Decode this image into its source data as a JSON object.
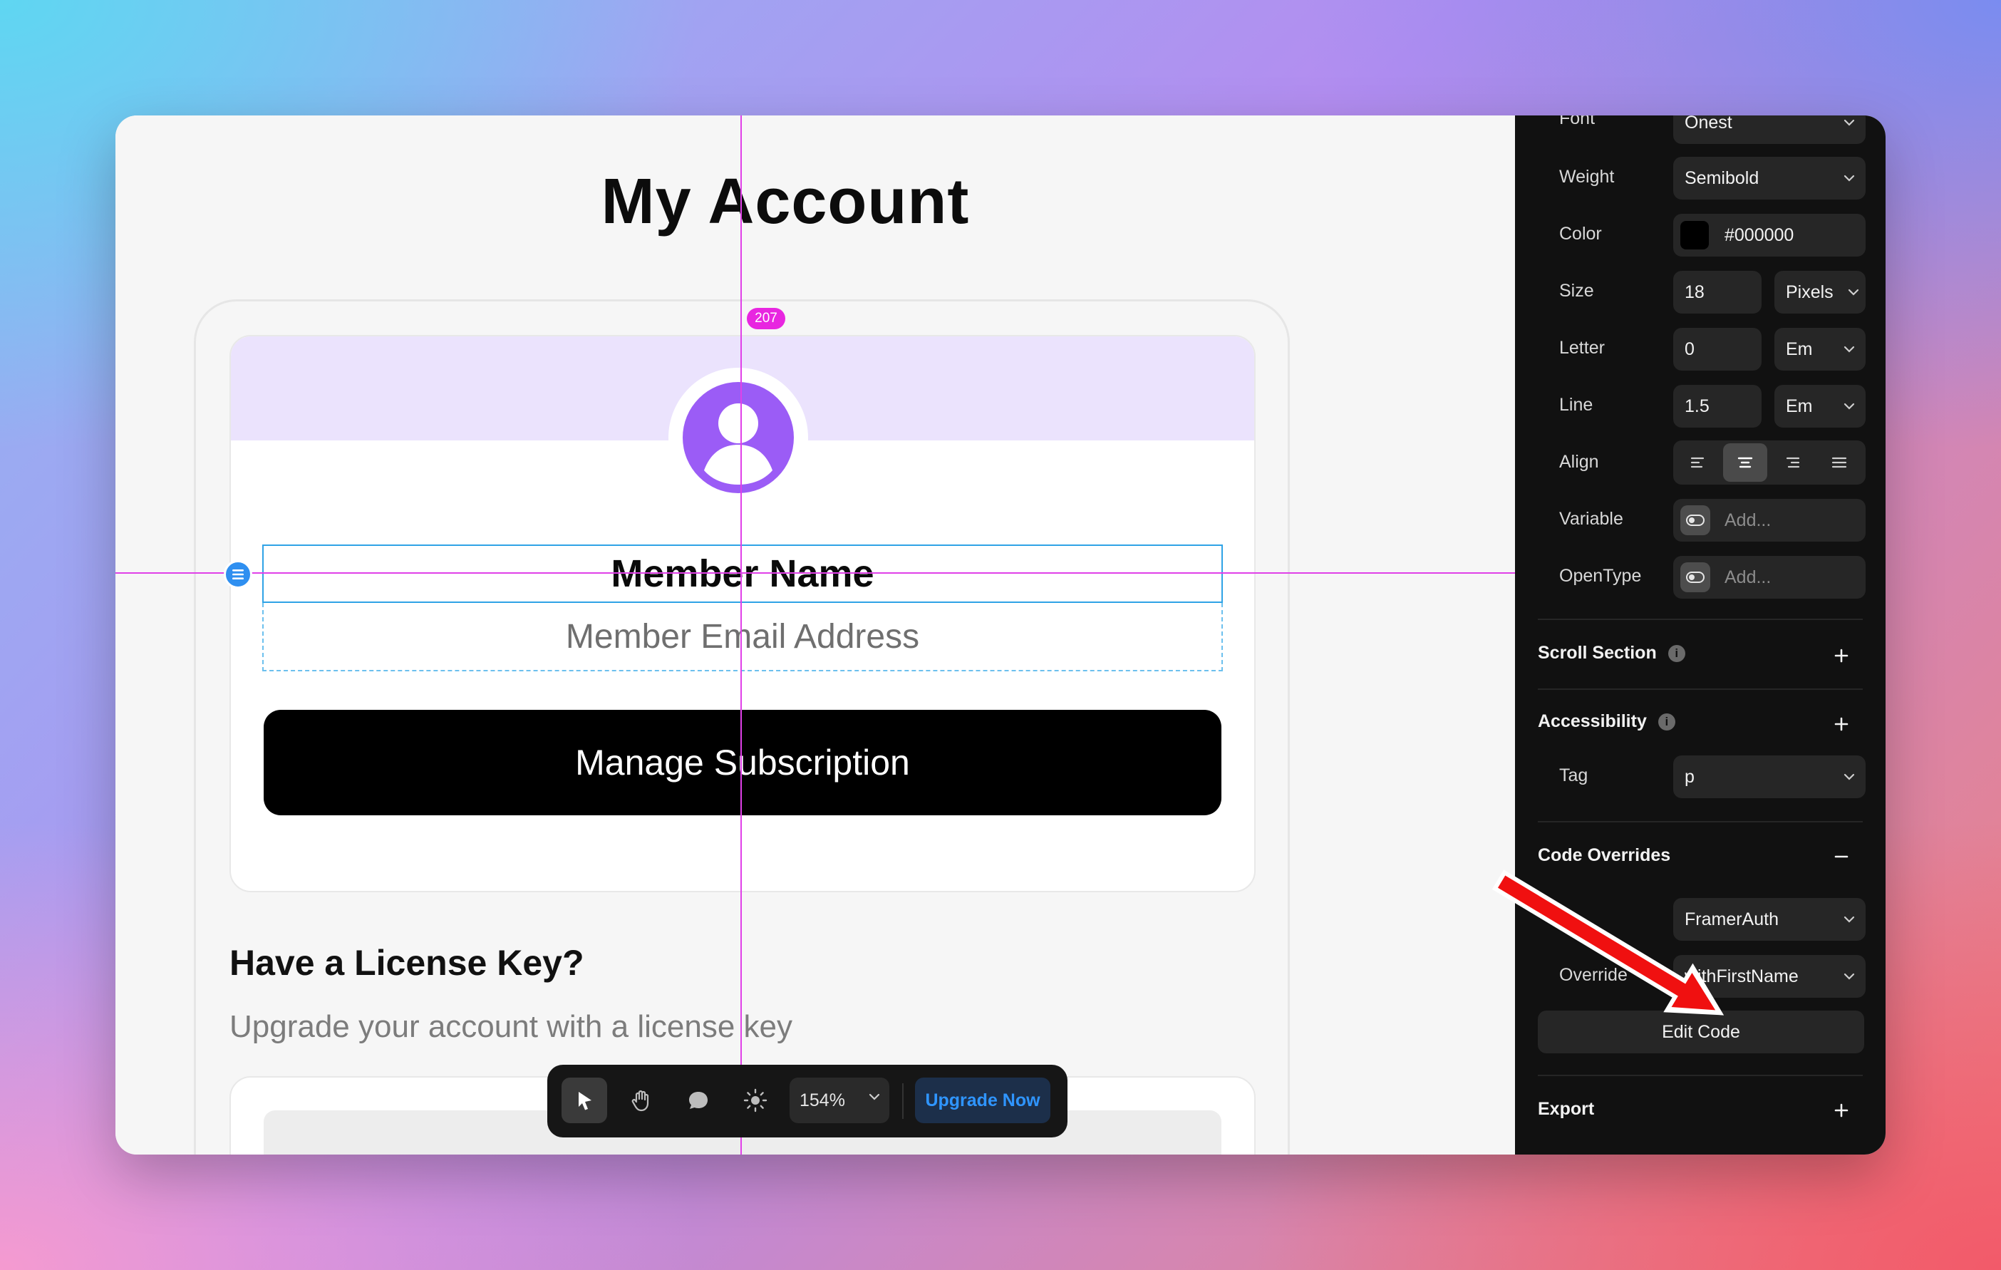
{
  "canvas": {
    "page_title": "My Account",
    "distance_badge": "207",
    "member_name": "Member Name",
    "member_email": "Member Email Address",
    "manage_button": "Manage Subscription",
    "license_title": "Have a License Key?",
    "license_subtitle": "Upgrade your account with a license key"
  },
  "toolbar": {
    "zoom": "154%",
    "upgrade_label": "Upgrade Now",
    "tools": [
      "select-tool-icon",
      "hand-tool-icon",
      "comment-icon",
      "theme-toggle-icon"
    ]
  },
  "panel": {
    "font": {
      "label": "Font",
      "value": "Onest"
    },
    "weight": {
      "label": "Weight",
      "value": "Semibold"
    },
    "color": {
      "label": "Color",
      "value": "#000000"
    },
    "size": {
      "label": "Size",
      "value": "18",
      "unit": "Pixels"
    },
    "letter": {
      "label": "Letter",
      "value": "0",
      "unit": "Em"
    },
    "line": {
      "label": "Line",
      "value": "1.5",
      "unit": "Em"
    },
    "align": {
      "label": "Align",
      "options": [
        "left",
        "center",
        "right",
        "justify"
      ],
      "selected": "center"
    },
    "variable": {
      "label": "Variable",
      "placeholder": "Add..."
    },
    "opentype": {
      "label": "OpenType",
      "placeholder": "Add..."
    },
    "scroll_section": "Scroll Section",
    "accessibility": "Accessibility",
    "tag": {
      "label": "Tag",
      "value": "p"
    },
    "code_overrides": "Code Overrides",
    "file": {
      "value": "FramerAuth"
    },
    "override": {
      "label": "Override",
      "value": "withFirstName"
    },
    "edit_code": "Edit Code",
    "export": "Export"
  },
  "colors": {
    "accent_purple": "#9b5cf6",
    "banner_lavender": "#ebe3fd",
    "guide_magenta": "#e040e8",
    "selection_blue": "#2fa3e6",
    "upgrade_blue": "#2f95ff",
    "annotation_arrow": "#f01010"
  }
}
